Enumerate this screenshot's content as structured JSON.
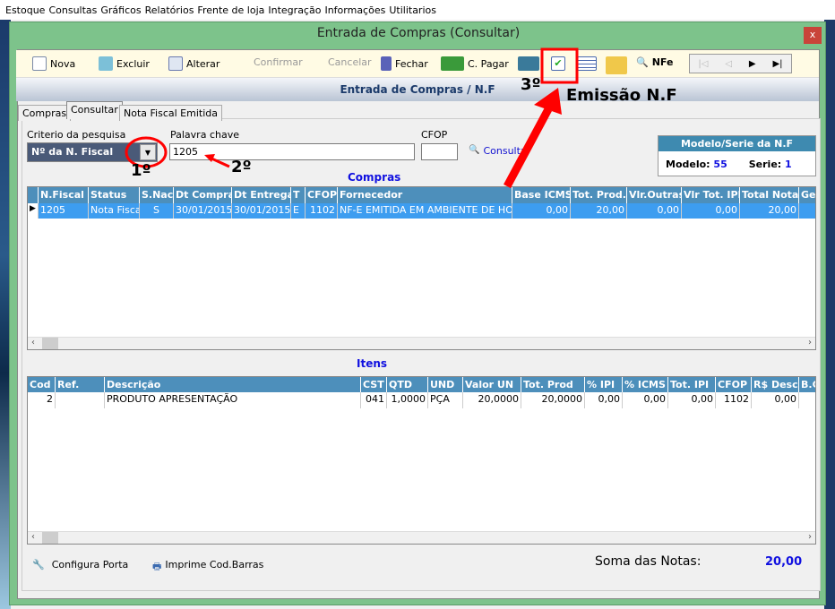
{
  "menubar": [
    "Estoque",
    "Consultas",
    "Gráficos",
    "Relatórios",
    "Frente de loja",
    "Integração",
    "Informações",
    "Utilitarios"
  ],
  "window": {
    "title": "Entrada de Compras  (Consultar)",
    "close": "x"
  },
  "toolbar": {
    "nova": "Nova",
    "excluir": "Excluir",
    "alterar": "Alterar",
    "confirmar": "Confirmar",
    "cancelar": "Cancelar",
    "fechar": "Fechar",
    "cpagar": "C. Pagar",
    "nfe": "NFe"
  },
  "header": "Entrada de Compras / N.F",
  "tabs": [
    "Compras",
    "Consultar",
    "Nota Fiscal Emitida"
  ],
  "search": {
    "criterio_label": "Criterio da pesquisa",
    "criterio_value": "Nº da N. Fiscal",
    "palavra_label": "Palavra chave",
    "palavra_value": "1205",
    "cfop_label": "CFOP",
    "cfop_value": "",
    "consultar": "Consultar"
  },
  "modelo": {
    "title": "Modelo/Serie da N.F",
    "modelo_label": "Modelo:",
    "modelo_value": "55",
    "serie_label": "Serie:",
    "serie_value": "1"
  },
  "compras": {
    "title": "Compras",
    "columns": [
      "N.Fiscal",
      "Status",
      "S.Nac.",
      "Dt Compra",
      "Dt Entrega",
      "T",
      "CFOP",
      "Fornecedor",
      "Base ICMS",
      "Tot. Prod.",
      "Vlr.Outras",
      "Vlr Tot. IPI",
      "Total Nota",
      "Ge"
    ],
    "rows": [
      [
        "1205",
        "Nota Fiscal",
        "S",
        "30/01/2015",
        "30/01/2015",
        "E",
        "1102",
        "NF-E EMITIDA EM AMBIENTE DE HOMOL",
        "0,00",
        "20,00",
        "0,00",
        "0,00",
        "20,00",
        ""
      ]
    ]
  },
  "itens": {
    "title": "Itens",
    "columns": [
      "Cod",
      "Ref.",
      "Descrição",
      "CST",
      "QTD",
      "UND",
      "Valor UN",
      "Tot. Prod",
      "% IPI",
      "% ICMS",
      "Tot. IPI",
      "CFOP",
      "R$ Desc.",
      "B.C"
    ],
    "rows": [
      [
        "2",
        "",
        "PRODUTO APRESENTAÇÃO",
        "041",
        "1,0000",
        "PÇA",
        "20,0000",
        "20,0000",
        "0,00",
        "0,00",
        "0,00",
        "1102",
        "0,00",
        ""
      ]
    ]
  },
  "footer": {
    "configura": "Configura Porta",
    "imprime": "Imprime  Cod.Barras",
    "soma_label": "Soma das Notas:",
    "soma_value": "20,00"
  },
  "annotations": {
    "step1": "1º",
    "step2": "2º",
    "step3": "3º",
    "emissao": "Emissão N.F"
  },
  "colors": {
    "window_border": "#7dc38b",
    "grid_header": "#4d8fbb",
    "selected_row": "#3d9df0",
    "annotation": "#ff0000"
  }
}
